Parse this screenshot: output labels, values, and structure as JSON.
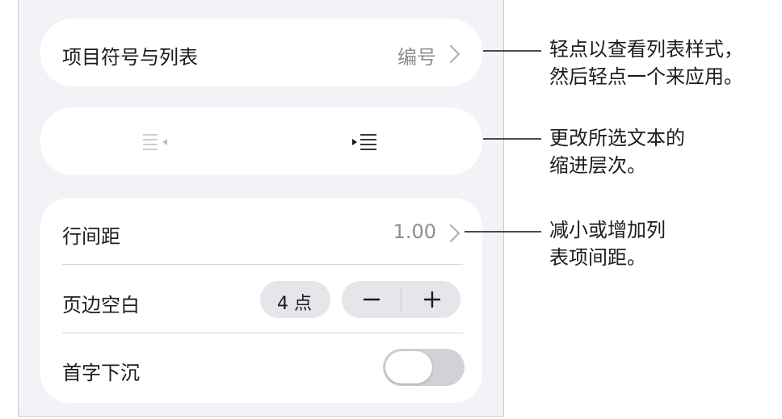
{
  "list_section": {
    "label": "项目符号与列表",
    "value": "编号",
    "chevron_icon": "chevron-right-icon"
  },
  "indent_section": {
    "decrease_icon": "decrease-indent-icon",
    "increase_icon": "increase-indent-icon"
  },
  "line_spacing": {
    "label": "行间距",
    "value": "1.00",
    "chevron_icon": "chevron-right-icon"
  },
  "margin": {
    "label": "页边空白",
    "value": "4 点",
    "minus_icon": "minus-icon",
    "plus_icon": "plus-icon"
  },
  "drop_cap": {
    "label": "首字下沉",
    "enabled": false
  },
  "callouts": {
    "list_style_line1": "轻点以查看列表样式，",
    "list_style_line2": "然后轻点一个来应用。",
    "indent_line1": "更改所选文本的",
    "indent_line2": "缩进层次。",
    "spacing_line1": "减小或增加列",
    "spacing_line2": "表项间距。"
  },
  "colors": {
    "panel_bg": "#f2f2f7",
    "card_bg": "#ffffff",
    "secondary_text": "#8e8e93",
    "toggle_off": "#d1d1d6"
  }
}
